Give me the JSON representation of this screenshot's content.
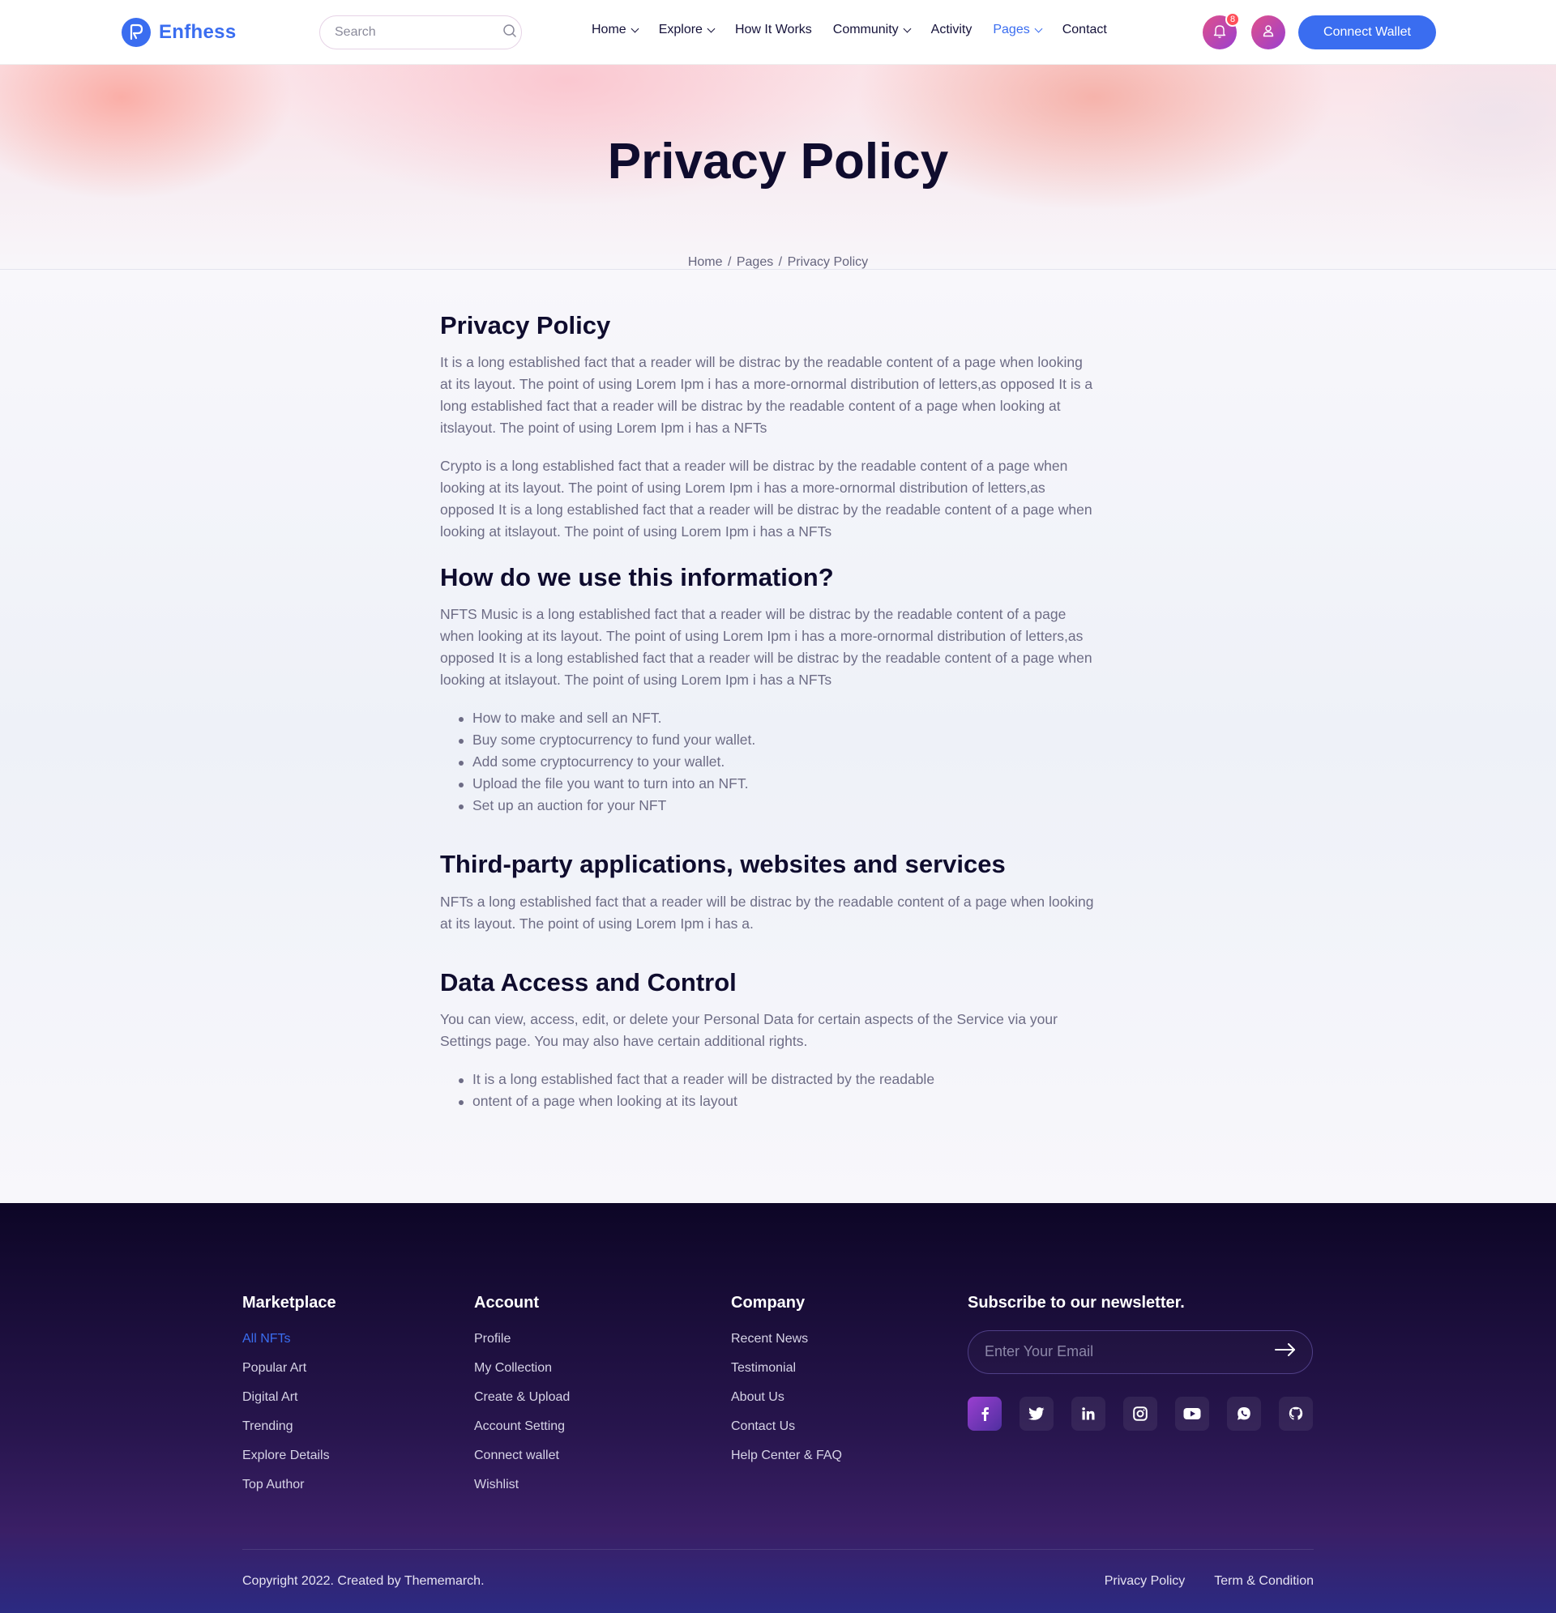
{
  "header": {
    "brand": "Enfhess",
    "search_placeholder": "Search",
    "nav": [
      {
        "label": "Home"
      },
      {
        "label": "Explore"
      },
      {
        "label": "How It Works"
      },
      {
        "label": "Community"
      },
      {
        "label": "Activity"
      },
      {
        "label": "Pages"
      },
      {
        "label": "Contact"
      }
    ],
    "notification_count": "8",
    "connect_label": "Connect Wallet",
    "accent_color": "#3a6df0"
  },
  "hero": {
    "title": "Privacy Policy",
    "breadcrumb": [
      "Home",
      "Pages",
      "Privacy Policy"
    ]
  },
  "article": {
    "s1": {
      "title": "Privacy Policy",
      "p1": "It is a long established fact that a reader will be distrac by the readable content of a page when looking at its layout. The point of using Lorem Ipm i has a more-ornormal distribution of letters,as opposed It is a long established fact that a reader will be distrac by the readable content of a page when looking at itslayout. The point of using Lorem Ipm i has a NFTs",
      "p2": "Crypto is a long established fact that a reader will be distrac by the readable content of a page when looking at its layout. The point of using Lorem Ipm i has a more-ornormal distribution of letters,as opposed It is a long established fact that a reader will be distrac by the readable content of a page when looking at itslayout. The point of using Lorem Ipm i has a NFTs"
    },
    "s2": {
      "title": "How do we use this information?",
      "p1": "NFTS Music is a long established fact that a reader will be distrac by the readable content of a page when looking at its layout. The point of using Lorem Ipm i has a more-ornormal distribution of letters,as opposed It is a long established fact that a reader will be distrac by the readable content of a page when looking at itslayout. The point of using Lorem Ipm i has a NFTs",
      "list": [
        "How to make and sell an NFT.",
        "Buy some cryptocurrency to fund your wallet.",
        "Add some cryptocurrency to your wallet.",
        "Upload the file you want to turn into an NFT.",
        "Set up an auction for your NFT"
      ]
    },
    "s3": {
      "title": "Third-party applications, websites and services",
      "p1": "NFTs a long established fact that a reader will be distrac by the readable content of a page when looking at its layout. The point of using Lorem Ipm i has a."
    },
    "s4": {
      "title": "Data Access and Control",
      "p1": "You can view, access, edit, or delete your Personal Data for certain aspects of the Service via your Settings page. You may also have certain additional rights.",
      "list": [
        "It is a long established fact that a reader will be distracted by the readable",
        "ontent of a page when looking at its layout"
      ]
    }
  },
  "footer": {
    "marketplace": {
      "title": "Marketplace",
      "links": [
        "All NFTs",
        "Popular Art",
        "Digital Art",
        "Trending",
        "Explore Details",
        "Top Author"
      ]
    },
    "account": {
      "title": "Account",
      "links": [
        "Profile",
        "My Collection",
        "Create & Upload",
        "Account Setting",
        "Connect wallet",
        "Wishlist"
      ]
    },
    "company": {
      "title": "Company",
      "links": [
        "Recent News",
        "Testimonial",
        "About Us",
        "Contact Us",
        "Help Center & FAQ"
      ]
    },
    "newsletter": {
      "title": "Subscribe to our newsletter.",
      "placeholder": "Enter Your Email"
    },
    "socials": [
      "facebook-icon",
      "twitter-icon",
      "linkedin-icon",
      "instagram-icon",
      "youtube-icon",
      "whatsapp-icon",
      "github-icon"
    ],
    "copyright": "Copyright 2022. Created by Thememarch.",
    "bottom_links": [
      "Privacy Policy",
      "Term & Condition"
    ]
  }
}
